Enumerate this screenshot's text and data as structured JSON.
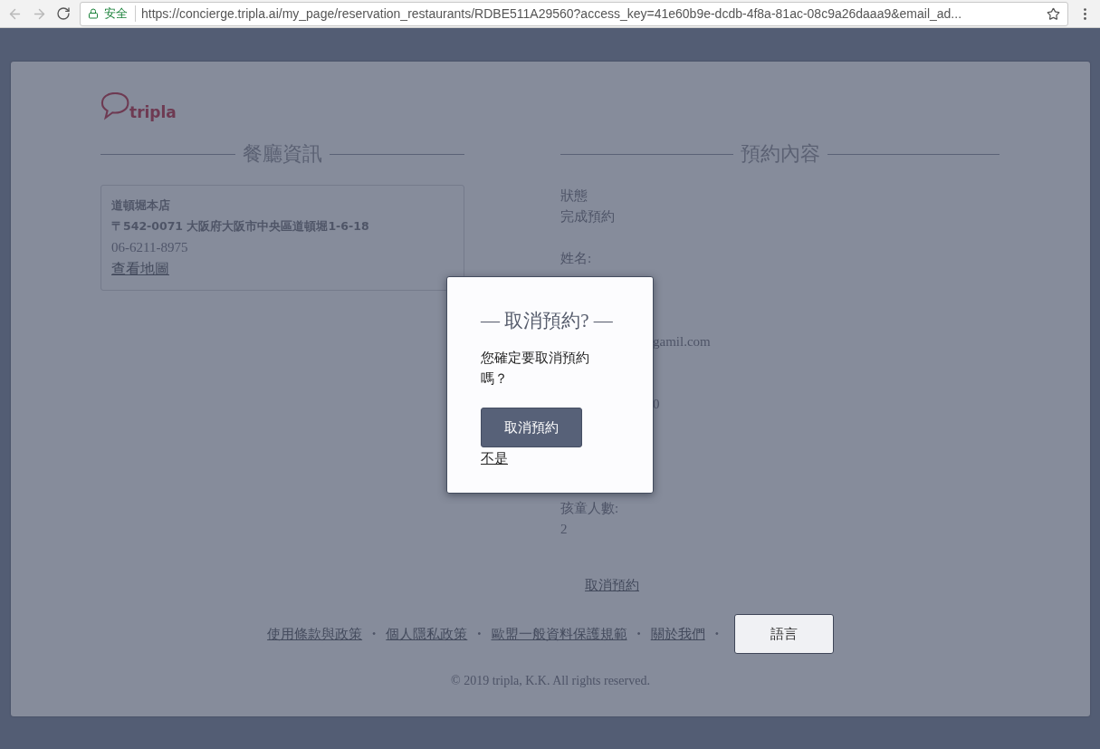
{
  "browser": {
    "security_label": "安全",
    "url": "https://concierge.tripla.ai/my_page/reservation_restaurants/RDBE511A29560?access_key=41e60b9e-dcdb-4f8a-81ac-08c9a26daaa9&email_ad..."
  },
  "logo": {
    "text": "tripla"
  },
  "restaurant_section": {
    "heading": "餐廳資訊",
    "name": "道頓堀本店",
    "address": "〒542-0071 大阪府大阪市中央區道頓堀1-6-18",
    "phone": "06-6211-8975",
    "map_link": "查看地圖"
  },
  "reservation_section": {
    "heading": "預約內容",
    "rows": [
      {
        "kind": "text",
        "text": "狀態"
      },
      {
        "kind": "text",
        "text": "完成預約"
      },
      {
        "kind": "blank"
      },
      {
        "kind": "text",
        "text": "姓名:"
      },
      {
        "kind": "blank"
      },
      {
        "kind": "blank"
      },
      {
        "kind": "blank"
      },
      {
        "kind": "cut",
        "text": "gamil.com"
      },
      {
        "kind": "blank"
      },
      {
        "kind": "blank"
      },
      {
        "kind": "cut",
        "text": "0"
      },
      {
        "kind": "blank"
      },
      {
        "kind": "blank"
      },
      {
        "kind": "blank"
      },
      {
        "kind": "blank"
      },
      {
        "kind": "text",
        "text": "孩童人數:"
      },
      {
        "kind": "text",
        "text": "2"
      }
    ],
    "cancel_link": "取消預約"
  },
  "footer": {
    "links": [
      "使用條款與政策",
      "個人隱私政策",
      "歐盟一般資料保護規範",
      "關於我們"
    ],
    "separator": "•",
    "language_button": "語言",
    "copyright": "© 2019 tripla, K.K. All rights reserved."
  },
  "modal": {
    "title": "— 取消預約? —",
    "message": "您確定要取消預約嗎？",
    "confirm_button": "取消預約",
    "dismiss_link": "不是"
  }
}
